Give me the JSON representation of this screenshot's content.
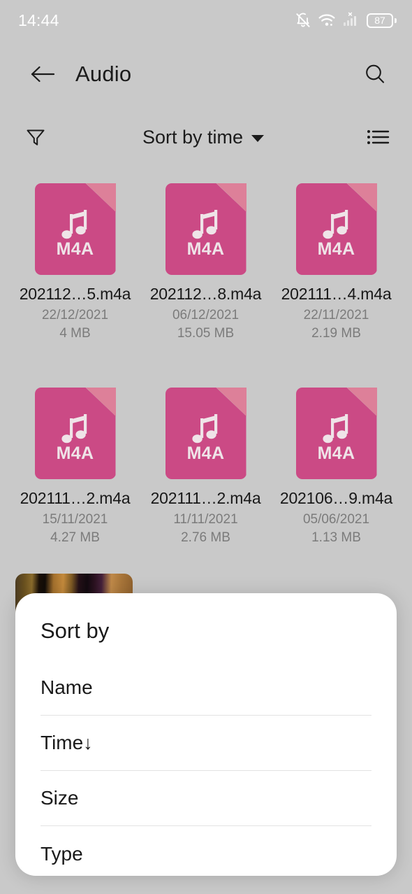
{
  "status_bar": {
    "time": "14:44",
    "battery_percent": "87",
    "icons": [
      "bell-off-icon",
      "wifi-icon",
      "cellular-signal-off-icon",
      "battery-icon"
    ]
  },
  "app_bar": {
    "back_icon": "back-arrow-icon",
    "title": "Audio",
    "search_icon": "search-icon"
  },
  "sort_bar": {
    "filter_icon": "filter-funnel-icon",
    "sort_label": "Sort by time",
    "caret_icon": "chevron-down-icon",
    "view_icon": "list-view-icon"
  },
  "files": [
    {
      "name": "202112…5.m4a",
      "date": "22/12/2021",
      "size": "4 MB",
      "ext": "M4A"
    },
    {
      "name": "202112…8.m4a",
      "date": "06/12/2021",
      "size": "15.05 MB",
      "ext": "M4A"
    },
    {
      "name": "202111…4.m4a",
      "date": "22/11/2021",
      "size": "2.19 MB",
      "ext": "M4A"
    },
    {
      "name": "202111…2.m4a",
      "date": "15/11/2021",
      "size": "4.27 MB",
      "ext": "M4A"
    },
    {
      "name": "202111…2.m4a",
      "date": "11/11/2021",
      "size": "2.76 MB",
      "ext": "M4A"
    },
    {
      "name": "202106…9.m4a",
      "date": "05/06/2021",
      "size": "1.13 MB",
      "ext": "M4A"
    }
  ],
  "sort_sheet": {
    "title": "Sort by",
    "options": [
      {
        "label": "Name",
        "arrow": ""
      },
      {
        "label": "Time",
        "arrow": "↓"
      },
      {
        "label": "Size",
        "arrow": ""
      },
      {
        "label": "Type",
        "arrow": ""
      }
    ]
  },
  "colors": {
    "background": "#c9c9c9",
    "file_icon_pink": "#cb4a85",
    "file_icon_fold": "#dd8099",
    "sheet_background": "#ffffff",
    "text_primary": "#1a1a1a",
    "text_secondary": "#7b7b7b"
  }
}
